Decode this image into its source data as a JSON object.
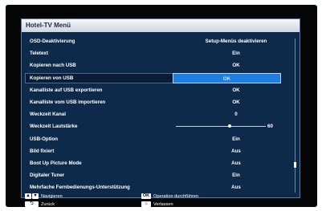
{
  "menu": {
    "title": "Hotel-TV Menü",
    "rows": [
      {
        "label": "OSD-Deaktivierung",
        "value": "Setup-Menüs deaktivieren"
      },
      {
        "label": "Teletext",
        "value": "Ein"
      },
      {
        "label": "Kopieren nach USB",
        "value": "OK"
      },
      {
        "label": "Kopieren von USB",
        "value": "OK"
      },
      {
        "label": "Kanalliste auf USB exportieren",
        "value": "OK"
      },
      {
        "label": "Kanalliste vom USB importieren",
        "value": "OK"
      },
      {
        "label": "Weckzeit Kanal",
        "value": "0"
      },
      {
        "label": "Weckzeit Lautstärke",
        "value": "60",
        "level": 0.6
      },
      {
        "label": "USB-Option",
        "value": "Ein"
      },
      {
        "label": "Bild fixiert",
        "value": "Aus"
      },
      {
        "label": "Boot Up Picture Mode",
        "value": "Aus"
      },
      {
        "label": "Digitaler Tuner",
        "value": "Ein"
      },
      {
        "label": "Mehrfache Fernbedienungs-Unterstützung",
        "value": "Aus"
      }
    ]
  },
  "footer": {
    "navigate": "Navigieren",
    "back": "Zurück",
    "ok_key": "OK",
    "confirm": "Operation durchführen",
    "exit": "Verlassen"
  },
  "colors": {
    "panel": "#0d2a4a",
    "highlight": "#1e7fe0"
  }
}
